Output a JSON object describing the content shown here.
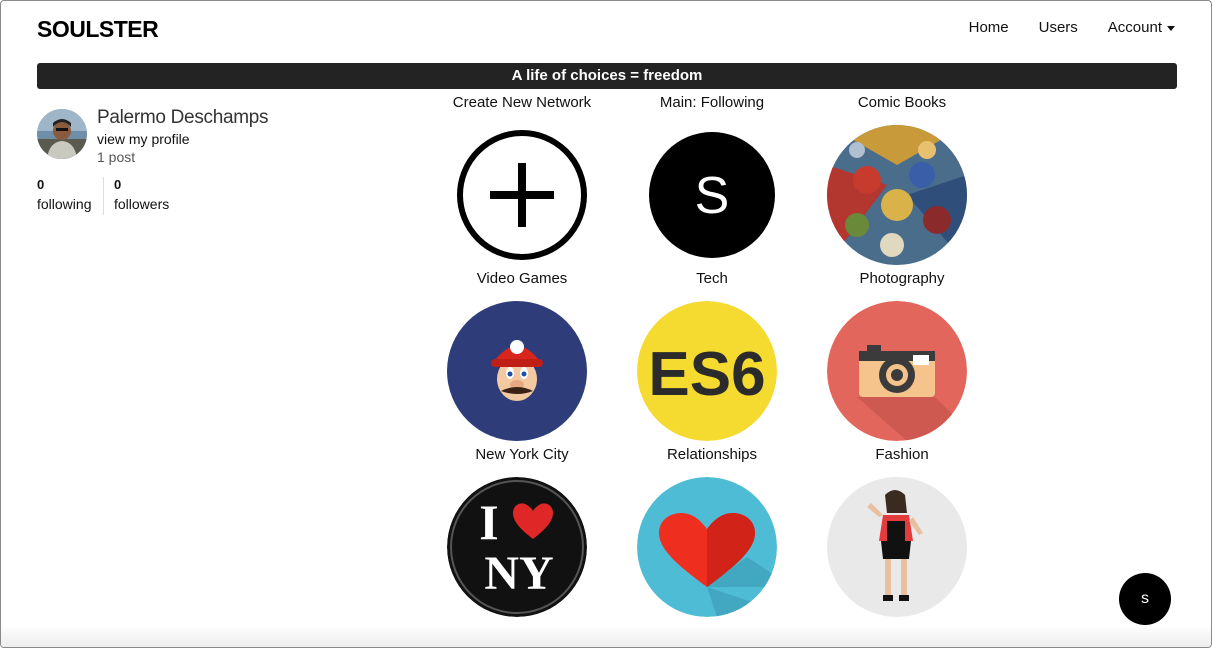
{
  "app": {
    "brand": "SOULSTER"
  },
  "nav": {
    "home": "Home",
    "users": "Users",
    "account": "Account"
  },
  "banner": {
    "text": "A life of choices = freedom"
  },
  "profile": {
    "name": "Palermo Deschamps",
    "view_profile": "view my profile",
    "posts": "1 post",
    "following_count": "0",
    "following_label": "following",
    "followers_count": "0",
    "followers_label": "followers"
  },
  "networks": [
    {
      "label": "Create New Network",
      "icon": "plus-circle-icon"
    },
    {
      "label": "Main: Following",
      "icon": "s-logo-icon",
      "glyph": "S"
    },
    {
      "label": "Comic Books",
      "icon": "comic-heroes-image"
    },
    {
      "label": "Video Games",
      "icon": "mario-image"
    },
    {
      "label": "Tech",
      "icon": "es6-logo",
      "glyph": "ES6"
    },
    {
      "label": "Photography",
      "icon": "camera-icon"
    },
    {
      "label": "New York City",
      "icon": "i-love-ny-logo",
      "glyph_top": "I",
      "glyph_bottom": "NY"
    },
    {
      "label": "Relationships",
      "icon": "heart-icon"
    },
    {
      "label": "Fashion",
      "icon": "fashion-model-image"
    }
  ],
  "fab": {
    "label": "s"
  },
  "colors": {
    "banner": "#232323",
    "es6_yellow": "#f5da2f",
    "photo_red": "#e2665c",
    "heart_blue": "#4fbcd6",
    "mario_blue": "#2e3d7a"
  }
}
